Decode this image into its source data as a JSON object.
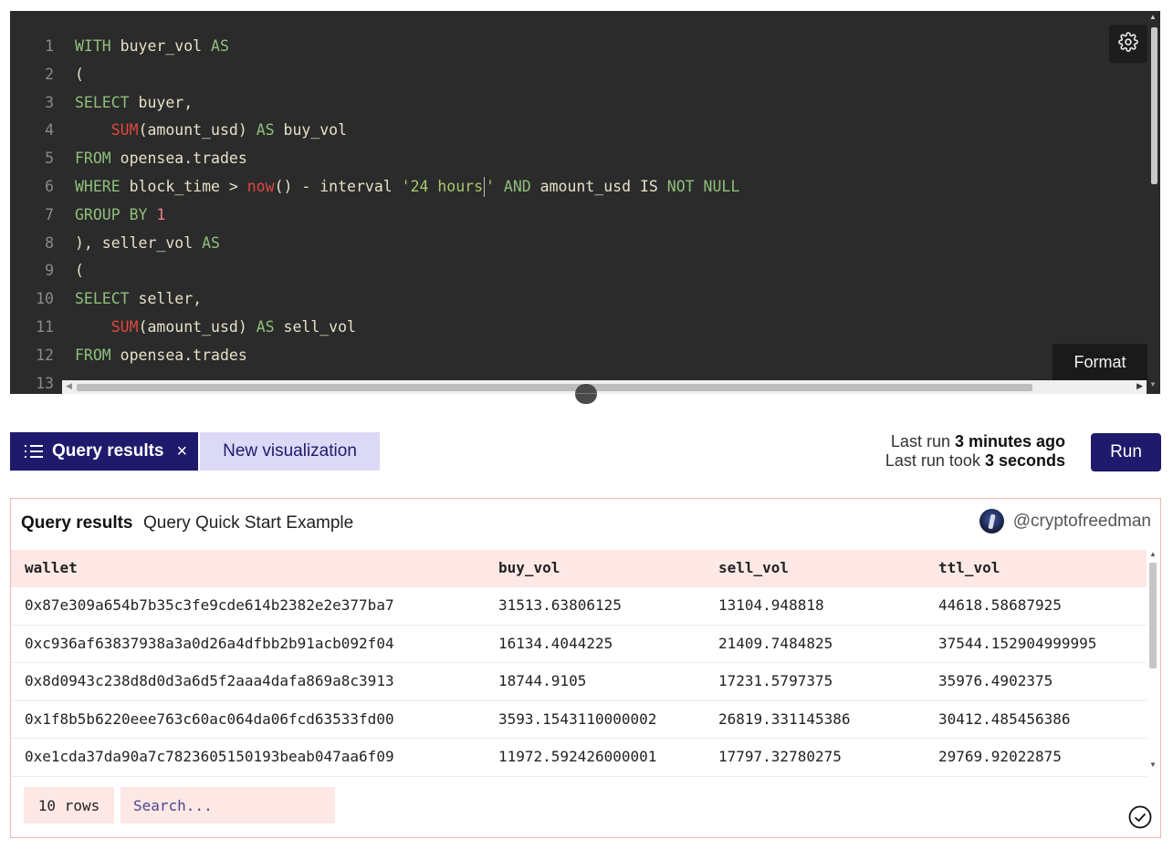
{
  "editor": {
    "lines": [
      {
        "n": "1",
        "tokens": [
          {
            "t": "WITH",
            "c": "kw"
          },
          {
            "t": " buyer_vol "
          },
          {
            "t": "AS",
            "c": "kw"
          }
        ]
      },
      {
        "n": "2",
        "tokens": [
          {
            "t": "("
          }
        ]
      },
      {
        "n": "3",
        "tokens": [
          {
            "t": "SELECT",
            "c": "kw"
          },
          {
            "t": " buyer,"
          }
        ]
      },
      {
        "n": "4",
        "tokens": [
          {
            "t": "    "
          },
          {
            "t": "SUM",
            "c": "fn"
          },
          {
            "t": "(amount_usd) "
          },
          {
            "t": "AS",
            "c": "kw"
          },
          {
            "t": " buy_vol"
          }
        ]
      },
      {
        "n": "5",
        "tokens": [
          {
            "t": "FROM",
            "c": "kw"
          },
          {
            "t": " opensea.trades"
          }
        ]
      },
      {
        "n": "6",
        "tokens": [
          {
            "t": "WHERE",
            "c": "kw"
          },
          {
            "t": " block_time > "
          },
          {
            "t": "now",
            "c": "fn"
          },
          {
            "t": "() - interval "
          },
          {
            "t": "'24 hours",
            "c": "str"
          },
          {
            "t": "",
            "c": "cursor"
          },
          {
            "t": "'",
            "c": "str"
          },
          {
            "t": " "
          },
          {
            "t": "AND",
            "c": "kw"
          },
          {
            "t": " amount_usd "
          },
          {
            "t": "IS",
            "c": ""
          },
          {
            "t": " "
          },
          {
            "t": "NOT",
            "c": "kw"
          },
          {
            "t": " "
          },
          {
            "t": "NULL",
            "c": "kw"
          }
        ]
      },
      {
        "n": "7",
        "tokens": [
          {
            "t": "GROUP BY",
            "c": "kw"
          },
          {
            "t": " "
          },
          {
            "t": "1",
            "c": "num"
          }
        ]
      },
      {
        "n": "8",
        "tokens": [
          {
            "t": "), seller_vol "
          },
          {
            "t": "AS",
            "c": "kw"
          }
        ]
      },
      {
        "n": "9",
        "tokens": [
          {
            "t": "("
          }
        ]
      },
      {
        "n": "10",
        "tokens": [
          {
            "t": "SELECT",
            "c": "kw"
          },
          {
            "t": " seller,"
          }
        ]
      },
      {
        "n": "11",
        "tokens": [
          {
            "t": "    "
          },
          {
            "t": "SUM",
            "c": "fn"
          },
          {
            "t": "(amount_usd) "
          },
          {
            "t": "AS",
            "c": "kw"
          },
          {
            "t": " sell_vol"
          }
        ]
      },
      {
        "n": "12",
        "tokens": [
          {
            "t": "FROM",
            "c": "kw"
          },
          {
            "t": " opensea.trades"
          }
        ]
      },
      {
        "n": "13",
        "tokens": []
      }
    ],
    "format_label": "Format",
    "settings_icon": "gear-icon"
  },
  "toolbar": {
    "tab_results_label": "Query results",
    "tab_close": "×",
    "tab_new_label": "New visualization",
    "last_run_prefix": "Last run ",
    "last_run_value": "3 minutes ago",
    "last_took_prefix": "Last run took ",
    "last_took_value": "3 seconds",
    "run_label": "Run"
  },
  "results": {
    "title": "Query results",
    "subtitle": "Query Quick Start Example",
    "author": "@cryptofreedman",
    "columns": [
      "wallet",
      "buy_vol",
      "sell_vol",
      "ttl_vol"
    ],
    "rows": [
      [
        "0x87e309a654b7b35c3fe9cde614b2382e2e377ba7",
        "31513.63806125",
        "13104.948818",
        "44618.58687925"
      ],
      [
        "0xc936af63837938a3a0d26a4dfbb2b91acb092f04",
        "16134.4044225",
        "21409.7484825",
        "37544.152904999995"
      ],
      [
        "0x8d0943c238d8d0d3a6d5f2aaa4dafa869a8c3913",
        "18744.9105",
        "17231.5797375",
        "35976.4902375"
      ],
      [
        "0x1f8b5b6220eee763c60ac064da06fcd63533fd00",
        "3593.1543110000002",
        "26819.331145386",
        "30412.485456386"
      ],
      [
        "0xe1cda37da90a7c7823605150193beab047aa6f09",
        "11972.592426000001",
        "17797.32780275",
        "29769.92022875"
      ]
    ],
    "row_count": "10 rows",
    "search_placeholder": "Search..."
  },
  "colors": {
    "brand": "#1f1a6b",
    "editor_bg": "#2b2b2b",
    "header_bg": "#fde8e6",
    "panel_border": "#f0b8b4"
  }
}
